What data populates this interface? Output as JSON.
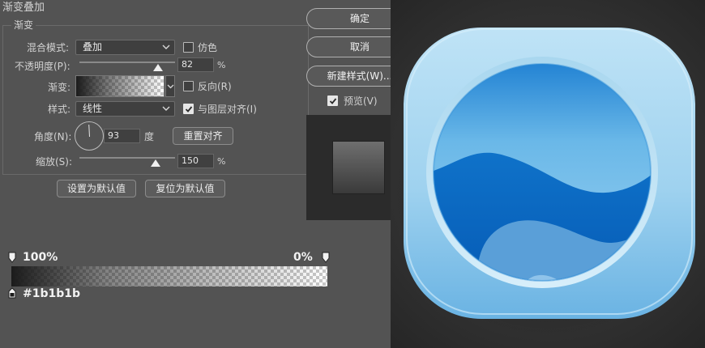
{
  "dialog": {
    "section_title": "渐变叠加",
    "group_title": "渐变",
    "blend_mode": {
      "label": "混合模式:",
      "value": "叠加"
    },
    "dither": {
      "label": "仿色",
      "checked": false
    },
    "opacity": {
      "label": "不透明度(P):",
      "value": "82",
      "unit": "%",
      "level": 0.82
    },
    "gradient": {
      "label": "渐变:"
    },
    "reverse": {
      "label": "反向(R)",
      "checked": false
    },
    "style": {
      "label": "样式:",
      "value": "线性"
    },
    "align": {
      "label": "与图层对齐(I)",
      "checked": true
    },
    "angle": {
      "label": "角度(N):",
      "value": "93",
      "unit": "度",
      "degrees": 93
    },
    "reset_align_button": "重置对齐",
    "scale": {
      "label": "缩放(S):",
      "value": "150",
      "unit": "%",
      "level": 0.8
    },
    "set_default_button": "设置为默认值",
    "reset_default_button": "复位为默认值"
  },
  "side_buttons": {
    "ok": "确定",
    "cancel": "取消",
    "new_style": "新建样式(W)...",
    "preview": {
      "label": "预览(V)",
      "checked": true
    }
  },
  "gradient_editor": {
    "left_stop_opacity": "100%",
    "right_stop_opacity": "0%",
    "color_stop_hex": "#1b1b1b"
  },
  "colors": {
    "dialog_bg": "#535353",
    "gradient_dark": "#1b1b1b",
    "icon_frame": "#9fd4f0",
    "icon_water_dark": "#0b66c3",
    "icon_water_light": "#6fb8e6"
  }
}
